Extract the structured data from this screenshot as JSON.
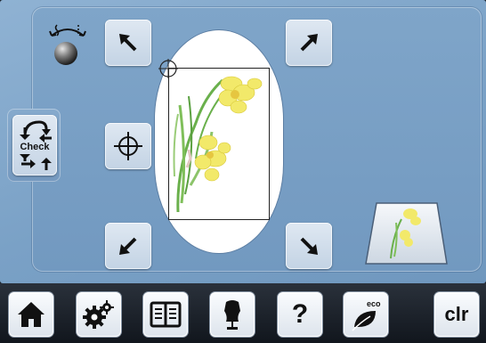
{
  "embroidery_check": {
    "check_button_label": "Check",
    "move_buttons": [
      {
        "name": "move-up-left",
        "direction": "up-left"
      },
      {
        "name": "move-up-right",
        "direction": "up-right"
      },
      {
        "name": "move-down-left",
        "direction": "down-left"
      },
      {
        "name": "move-down-right",
        "direction": "down-right"
      },
      {
        "name": "center",
        "direction": "center"
      }
    ],
    "colors": {
      "screen": "#7fa5c9",
      "button": "#d3dfeb",
      "hoop": "#ffffff",
      "bottom_bar": "#1a2028"
    }
  },
  "bottom_bar": {
    "items": [
      {
        "name": "home",
        "icon": "home-icon"
      },
      {
        "name": "setup",
        "icon": "gears-icon"
      },
      {
        "name": "tutorial",
        "icon": "book-icon"
      },
      {
        "name": "consultant",
        "icon": "dress-form-icon"
      },
      {
        "name": "help",
        "icon": "question-icon",
        "label": "?"
      },
      {
        "name": "eco",
        "icon": "leaf-icon",
        "label": "eco"
      },
      {
        "name": "clear",
        "label": "clr"
      }
    ]
  }
}
